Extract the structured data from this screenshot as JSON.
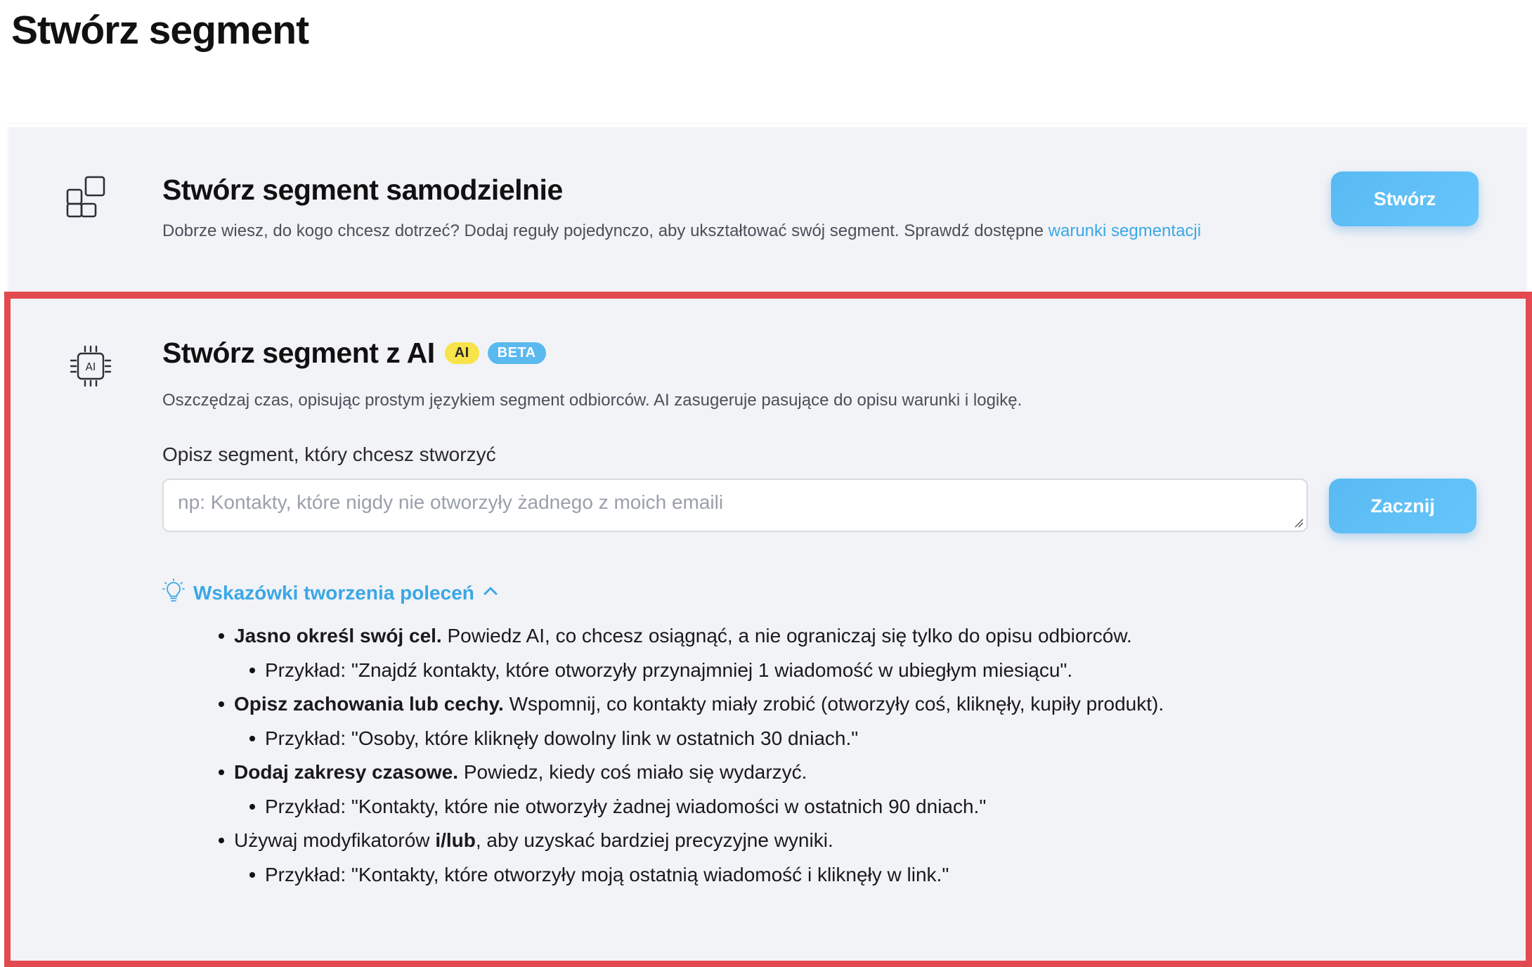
{
  "page": {
    "title": "Stwórz segment"
  },
  "manual": {
    "title": "Stwórz segment samodzielnie",
    "description": "Dobrze wiesz, do kogo chcesz dotrzeć? Dodaj reguły pojedynczo, aby ukształtować swój segment. Sprawdź dostępne ",
    "link_text": "warunki segmentacji",
    "button_label": "Stwórz",
    "icon": "blocks-icon"
  },
  "ai": {
    "title": "Stwórz segment z AI",
    "badge_ai": "AI",
    "badge_beta": "BETA",
    "description": "Oszczędzaj czas, opisując prostym językiem segment odbiorców. AI zasugeruje pasujące do opisu warunki i logikę.",
    "field_label": "Opisz segment, który chcesz stworzyć",
    "input_value": "",
    "input_placeholder": "np: Kontakty, które nigdy nie otworzyły żadnego z moich emaili",
    "button_label": "Zacznij",
    "icon": "ai-chip-icon",
    "tips": {
      "toggle_label": "Wskazówki tworzenia poleceń",
      "toggle_icon": "lightbulb-icon",
      "chevron_icon": "chevron-up-icon",
      "items": [
        {
          "strong": "Jasno określ swój cel.",
          "text": " Powiedz AI, co chcesz osiągnąć, a nie ograniczaj się tylko do opisu odbiorców.",
          "example": "Przykład: \"Znajdź kontakty, które otworzyły przynajmniej 1 wiadomość w ubiegłym miesiącu\"."
        },
        {
          "strong": "Opisz zachowania lub cechy.",
          "text": " Wspomnij, co kontakty miały zrobić (otworzyły coś, kliknęły, kupiły produkt).",
          "example": "Przykład: \"Osoby, które kliknęły dowolny link w ostatnich 30 dniach.\""
        },
        {
          "strong": "Dodaj zakresy czasowe.",
          "text": " Powiedz, kiedy coś miało się wydarzyć.",
          "example": "Przykład: \"Kontakty, które nie otworzyły żadnej wiadomości w ostatnich 90 dniach.\""
        },
        {
          "prefix": "Używaj modyfikatorów ",
          "strong": "i/lub",
          "text": ", aby uzyskać bardziej precyzyjne wyniki.",
          "example": "Przykład: \"Kontakty, które otworzyły moją ostatnią wiadomość i kliknęły w link.\""
        }
      ]
    }
  },
  "colors": {
    "accent": "#3aa7e6",
    "button": "#5ab9ee",
    "highlight_border": "#e24a4f",
    "card_bg": "#f2f3f7",
    "badge_ai": "#f7e34a"
  }
}
